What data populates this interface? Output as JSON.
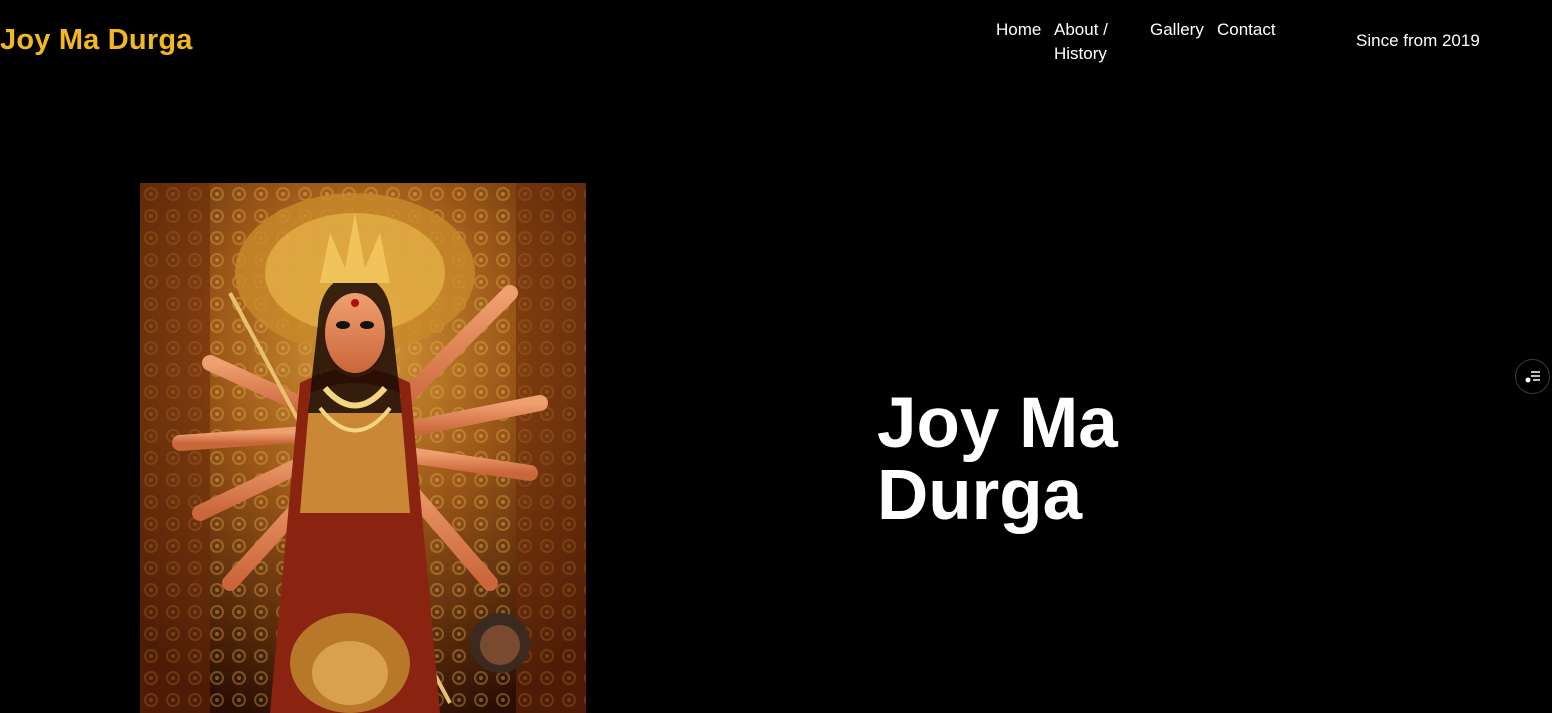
{
  "header": {
    "brand": "Joy Ma Durga",
    "nav": {
      "home": "Home",
      "about": "About / History",
      "gallery": "Gallery",
      "contact": "Contact"
    },
    "since": "Since from 2019"
  },
  "hero": {
    "title": "Joy Ma Durga",
    "image_icon": "durga-idol-image"
  },
  "floating": {
    "icon": "settings-list-icon"
  },
  "colors": {
    "background": "#000000",
    "brand": "#f2b824",
    "text": "#ffffff"
  }
}
